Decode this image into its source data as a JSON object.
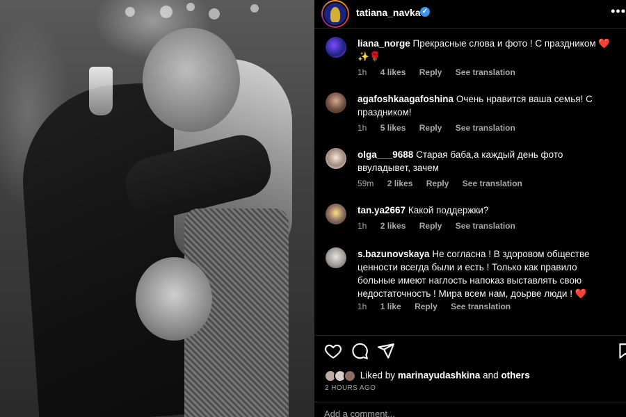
{
  "header": {
    "username": "tatiana_navka",
    "verified_icon": "verified-badge-icon",
    "more_icon": "more-options-icon"
  },
  "comments": [
    {
      "username": "liana_norge",
      "text": "Прекрасные слова и фото ! С праздником ❤️✨🌹",
      "time": "1h",
      "likes": "4 likes",
      "reply": "Reply",
      "translate": "See translation"
    },
    {
      "username": "agafoshkaagafoshina",
      "text": "Очень нравится ваша семья! С праздником!",
      "time": "1h",
      "likes": "5 likes",
      "reply": "Reply",
      "translate": "See translation"
    },
    {
      "username": "olga___9688",
      "text": "Старая баба,а каждый день фото ввуладывет, зачем",
      "time": "59m",
      "likes": "2 likes",
      "reply": "Reply",
      "translate": "See translation"
    },
    {
      "username": "tan.ya2667",
      "text": "Какой поддержки?",
      "time": "1h",
      "likes": "2 likes",
      "reply": "Reply",
      "translate": "See translation"
    },
    {
      "username": "s.bazunovskaya",
      "text": "Не согласна ! В здоровом обществе ценности всегда были и есть ! Только как правило больные имеют наглость напоказ выставлять свою недостаточность ! Мира всем нам, доьрве люди ! ❤️",
      "time": "1h",
      "likes": "1 like",
      "reply": "Reply",
      "translate": "See translation"
    }
  ],
  "actions": {
    "like_icon": "heart-icon",
    "comment_icon": "comment-icon",
    "share_icon": "share-icon",
    "save_icon": "bookmark-icon"
  },
  "likes_summary": {
    "prefix": "Liked by",
    "user": "marinayudashkina",
    "conjunction": "and",
    "others": "others"
  },
  "time_ago": "2 HOURS AGO",
  "add_comment_placeholder": "Add a comment..."
}
